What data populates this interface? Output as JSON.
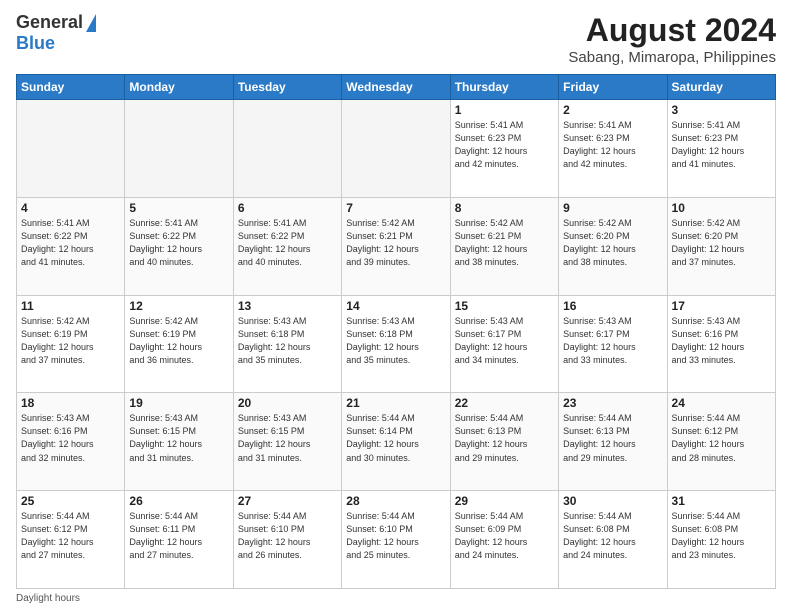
{
  "header": {
    "logo_general": "General",
    "logo_blue": "Blue",
    "main_title": "August 2024",
    "sub_title": "Sabang, Mimaropa, Philippines"
  },
  "days_of_week": [
    "Sunday",
    "Monday",
    "Tuesday",
    "Wednesday",
    "Thursday",
    "Friday",
    "Saturday"
  ],
  "weeks": [
    [
      {
        "day": "",
        "info": ""
      },
      {
        "day": "",
        "info": ""
      },
      {
        "day": "",
        "info": ""
      },
      {
        "day": "",
        "info": ""
      },
      {
        "day": "1",
        "info": "Sunrise: 5:41 AM\nSunset: 6:23 PM\nDaylight: 12 hours\nand 42 minutes."
      },
      {
        "day": "2",
        "info": "Sunrise: 5:41 AM\nSunset: 6:23 PM\nDaylight: 12 hours\nand 42 minutes."
      },
      {
        "day": "3",
        "info": "Sunrise: 5:41 AM\nSunset: 6:23 PM\nDaylight: 12 hours\nand 41 minutes."
      }
    ],
    [
      {
        "day": "4",
        "info": "Sunrise: 5:41 AM\nSunset: 6:22 PM\nDaylight: 12 hours\nand 41 minutes."
      },
      {
        "day": "5",
        "info": "Sunrise: 5:41 AM\nSunset: 6:22 PM\nDaylight: 12 hours\nand 40 minutes."
      },
      {
        "day": "6",
        "info": "Sunrise: 5:41 AM\nSunset: 6:22 PM\nDaylight: 12 hours\nand 40 minutes."
      },
      {
        "day": "7",
        "info": "Sunrise: 5:42 AM\nSunset: 6:21 PM\nDaylight: 12 hours\nand 39 minutes."
      },
      {
        "day": "8",
        "info": "Sunrise: 5:42 AM\nSunset: 6:21 PM\nDaylight: 12 hours\nand 38 minutes."
      },
      {
        "day": "9",
        "info": "Sunrise: 5:42 AM\nSunset: 6:20 PM\nDaylight: 12 hours\nand 38 minutes."
      },
      {
        "day": "10",
        "info": "Sunrise: 5:42 AM\nSunset: 6:20 PM\nDaylight: 12 hours\nand 37 minutes."
      }
    ],
    [
      {
        "day": "11",
        "info": "Sunrise: 5:42 AM\nSunset: 6:19 PM\nDaylight: 12 hours\nand 37 minutes."
      },
      {
        "day": "12",
        "info": "Sunrise: 5:42 AM\nSunset: 6:19 PM\nDaylight: 12 hours\nand 36 minutes."
      },
      {
        "day": "13",
        "info": "Sunrise: 5:43 AM\nSunset: 6:18 PM\nDaylight: 12 hours\nand 35 minutes."
      },
      {
        "day": "14",
        "info": "Sunrise: 5:43 AM\nSunset: 6:18 PM\nDaylight: 12 hours\nand 35 minutes."
      },
      {
        "day": "15",
        "info": "Sunrise: 5:43 AM\nSunset: 6:17 PM\nDaylight: 12 hours\nand 34 minutes."
      },
      {
        "day": "16",
        "info": "Sunrise: 5:43 AM\nSunset: 6:17 PM\nDaylight: 12 hours\nand 33 minutes."
      },
      {
        "day": "17",
        "info": "Sunrise: 5:43 AM\nSunset: 6:16 PM\nDaylight: 12 hours\nand 33 minutes."
      }
    ],
    [
      {
        "day": "18",
        "info": "Sunrise: 5:43 AM\nSunset: 6:16 PM\nDaylight: 12 hours\nand 32 minutes."
      },
      {
        "day": "19",
        "info": "Sunrise: 5:43 AM\nSunset: 6:15 PM\nDaylight: 12 hours\nand 31 minutes."
      },
      {
        "day": "20",
        "info": "Sunrise: 5:43 AM\nSunset: 6:15 PM\nDaylight: 12 hours\nand 31 minutes."
      },
      {
        "day": "21",
        "info": "Sunrise: 5:44 AM\nSunset: 6:14 PM\nDaylight: 12 hours\nand 30 minutes."
      },
      {
        "day": "22",
        "info": "Sunrise: 5:44 AM\nSunset: 6:13 PM\nDaylight: 12 hours\nand 29 minutes."
      },
      {
        "day": "23",
        "info": "Sunrise: 5:44 AM\nSunset: 6:13 PM\nDaylight: 12 hours\nand 29 minutes."
      },
      {
        "day": "24",
        "info": "Sunrise: 5:44 AM\nSunset: 6:12 PM\nDaylight: 12 hours\nand 28 minutes."
      }
    ],
    [
      {
        "day": "25",
        "info": "Sunrise: 5:44 AM\nSunset: 6:12 PM\nDaylight: 12 hours\nand 27 minutes."
      },
      {
        "day": "26",
        "info": "Sunrise: 5:44 AM\nSunset: 6:11 PM\nDaylight: 12 hours\nand 27 minutes."
      },
      {
        "day": "27",
        "info": "Sunrise: 5:44 AM\nSunset: 6:10 PM\nDaylight: 12 hours\nand 26 minutes."
      },
      {
        "day": "28",
        "info": "Sunrise: 5:44 AM\nSunset: 6:10 PM\nDaylight: 12 hours\nand 25 minutes."
      },
      {
        "day": "29",
        "info": "Sunrise: 5:44 AM\nSunset: 6:09 PM\nDaylight: 12 hours\nand 24 minutes."
      },
      {
        "day": "30",
        "info": "Sunrise: 5:44 AM\nSunset: 6:08 PM\nDaylight: 12 hours\nand 24 minutes."
      },
      {
        "day": "31",
        "info": "Sunrise: 5:44 AM\nSunset: 6:08 PM\nDaylight: 12 hours\nand 23 minutes."
      }
    ]
  ],
  "footer": {
    "daylight_hours": "Daylight hours"
  }
}
